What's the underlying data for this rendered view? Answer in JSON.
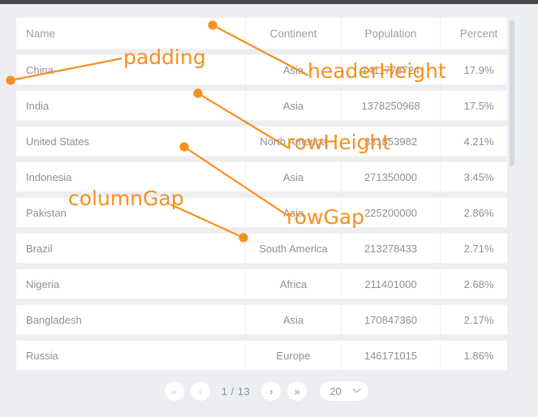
{
  "grid": {
    "columns": [
      {
        "key": "name",
        "label": "Name",
        "align": "left"
      },
      {
        "key": "continent",
        "label": "Continent",
        "align": "center"
      },
      {
        "key": "population",
        "label": "Population",
        "align": "center"
      },
      {
        "key": "percent",
        "label": "Percent",
        "align": "center"
      }
    ],
    "rows": [
      {
        "name": "China",
        "continent": "Asia",
        "population": "1411778724",
        "percent": "17.9%"
      },
      {
        "name": "India",
        "continent": "Asia",
        "population": "1378250968",
        "percent": "17.5%"
      },
      {
        "name": "United States",
        "continent": "North America",
        "population": "331853982",
        "percent": "4.21%"
      },
      {
        "name": "Indonesia",
        "continent": "Asia",
        "population": "271350000",
        "percent": "3.45%"
      },
      {
        "name": "Pakistan",
        "continent": "Asia",
        "population": "225200000",
        "percent": "2.86%"
      },
      {
        "name": "Brazil",
        "continent": "South America",
        "population": "213278433",
        "percent": "2.71%"
      },
      {
        "name": "Nigeria",
        "continent": "Africa",
        "population": "211401000",
        "percent": "2.68%"
      },
      {
        "name": "Bangladesh",
        "continent": "Asia",
        "population": "170847360",
        "percent": "2.17%"
      },
      {
        "name": "Russia",
        "continent": "Europe",
        "population": "146171015",
        "percent": "1.86%"
      }
    ]
  },
  "pagination": {
    "first_label": "«",
    "prev_label": "‹",
    "page_label": "1 / 13",
    "current_page": 1,
    "total_pages": 13,
    "next_label": "›",
    "last_label": "»",
    "page_size": "20",
    "chevron_label": "⌄"
  },
  "annotations": [
    {
      "id": "padding",
      "text": "padding"
    },
    {
      "id": "headerHeight",
      "text": "headerHeight"
    },
    {
      "id": "rowHeight",
      "text": "rowHeight"
    },
    {
      "id": "columnGap",
      "text": "columnGap"
    },
    {
      "id": "rowGap",
      "text": "rowGap"
    }
  ],
  "colors": {
    "annotation": "#f7901e",
    "page_background": "#3f4447",
    "panel_background": "#eceef2",
    "row_background": "#ffffff",
    "text": "#8b9199",
    "scrollbar_thumb": "#d2d8e2"
  }
}
